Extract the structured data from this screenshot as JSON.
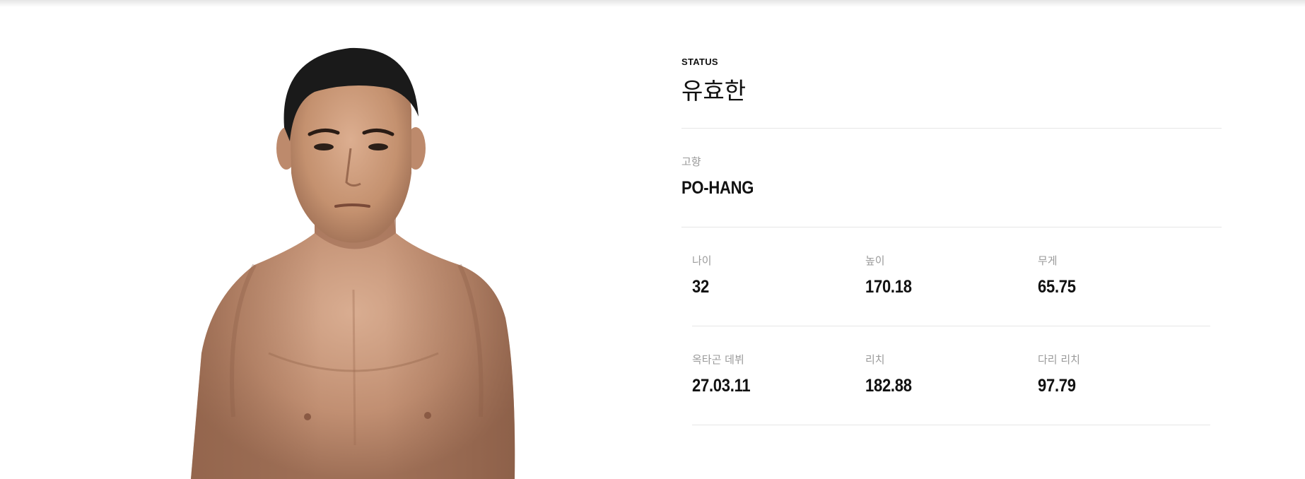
{
  "fighter": {
    "status_label": "STATUS",
    "name": "유효한"
  },
  "hometown": {
    "label": "고향",
    "value": "PO-HANG"
  },
  "stats_row1": [
    {
      "label": "나이",
      "value": "32"
    },
    {
      "label": "높이",
      "value": "170.18"
    },
    {
      "label": "무게",
      "value": "65.75"
    }
  ],
  "stats_row2": [
    {
      "label": "옥타곤 데뷔",
      "value": "27.03.11"
    },
    {
      "label": "리치",
      "value": "182.88"
    },
    {
      "label": "다리 리치",
      "value": "97.79"
    }
  ],
  "icons": {
    "photo": "fighter-portrait"
  },
  "colors": {
    "label": "#9a9a9a",
    "value": "#111111",
    "divider": "#e6e6e6",
    "skin": "#c99a7d",
    "hair": "#1a1a1a"
  }
}
